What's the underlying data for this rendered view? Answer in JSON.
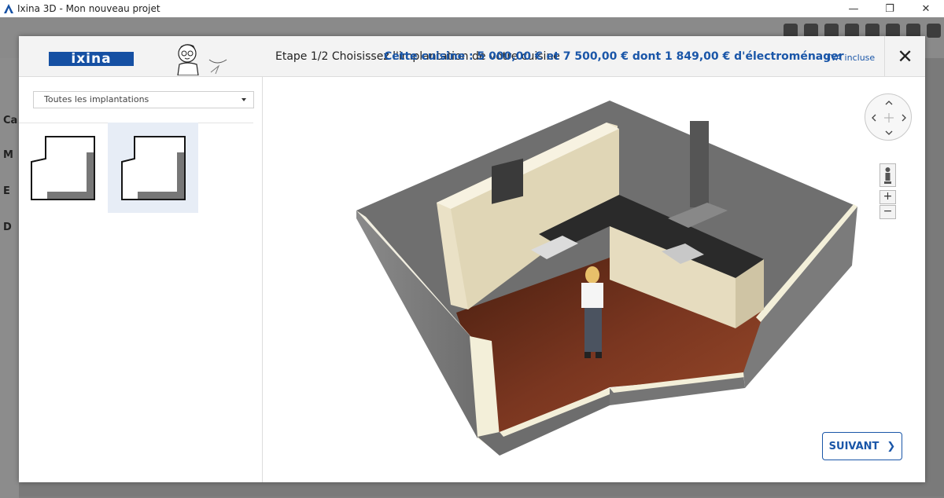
{
  "window": {
    "title": "Ixina 3D - Mon nouveau projet",
    "minimize_icon": "minimize-icon",
    "restore_icon": "restore-icon",
    "close_icon": "close-icon"
  },
  "background_app": {
    "sidebar_letters": [
      "Ca",
      "M",
      "E",
      "D"
    ]
  },
  "modal": {
    "logo_text": "ixina",
    "step_title": "Etape 1/2 Choisissez l'implantation de votre cuisine",
    "price_text": "Cette cuisine : 5 000,00 € et 7 500,00 € dont 1 849,00 € d'électroménager",
    "tva_label": "TVA incluse",
    "close_label": "✕",
    "brand_color": "#1650a3"
  },
  "filter": {
    "selected": "Toutes les implantations"
  },
  "layouts": [
    {
      "label": "",
      "selected": false
    },
    {
      "label": "",
      "selected": true
    }
  ],
  "viewport": {
    "next_button": "SUIVANT",
    "zoom_in": "+",
    "zoom_out": "−"
  }
}
